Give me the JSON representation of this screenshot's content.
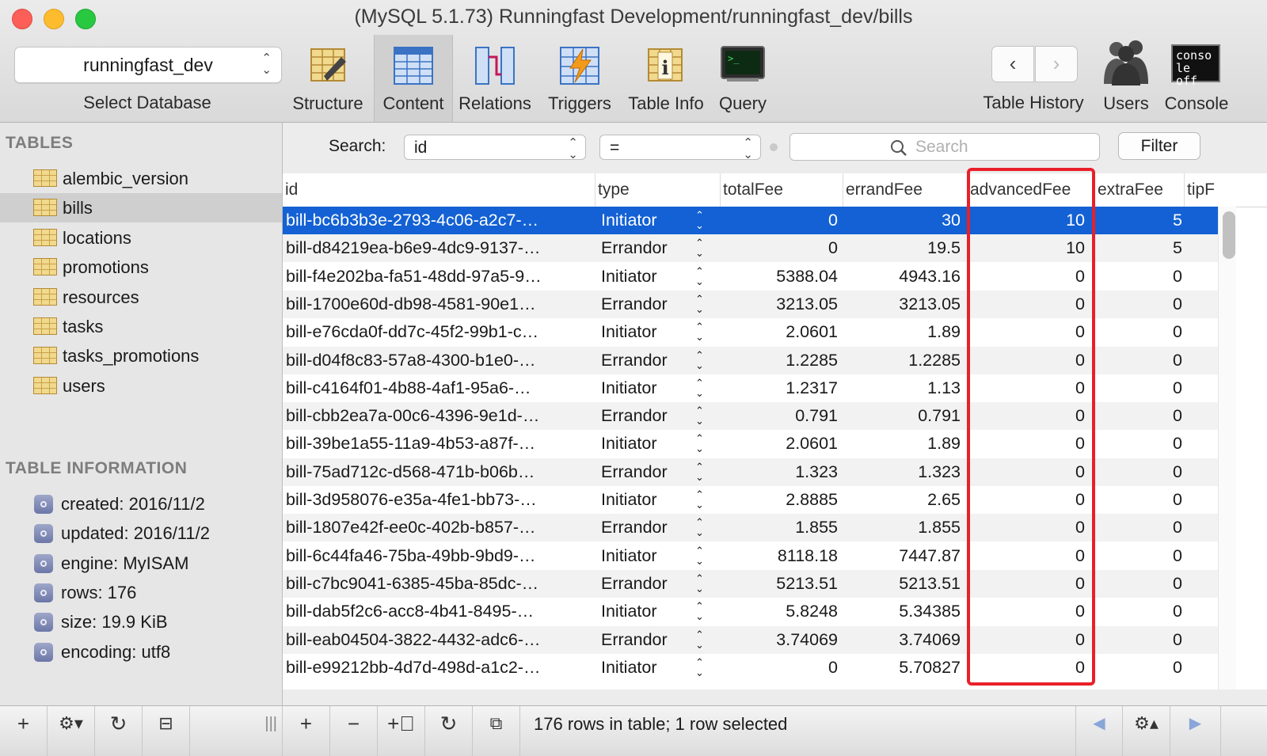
{
  "window": {
    "title": "(MySQL 5.1.73) Runningfast Development/runningfast_dev/bills"
  },
  "toolbar": {
    "database": {
      "value": "runningfast_dev",
      "label": "Select Database"
    },
    "tools": [
      {
        "label": "Structure",
        "icon": "structure-icon"
      },
      {
        "label": "Content",
        "icon": "content-icon"
      },
      {
        "label": "Relations",
        "icon": "relations-icon"
      },
      {
        "label": "Triggers",
        "icon": "triggers-icon"
      },
      {
        "label": "Table Info",
        "icon": "table-info-icon"
      },
      {
        "label": "Query",
        "icon": "query-icon"
      }
    ],
    "history_label": "Table History",
    "users_label": "Users",
    "console_label": "Console",
    "console_icon_text": "conso le off"
  },
  "sidebar": {
    "tables_heading": "TABLES",
    "tables": [
      "alembic_version",
      "bills",
      "locations",
      "promotions",
      "resources",
      "tasks",
      "tasks_promotions",
      "users"
    ],
    "selected_table": "bills",
    "info_heading": "TABLE INFORMATION",
    "info": [
      "created: 2016/11/2",
      "updated: 2016/11/2",
      "engine: MyISAM",
      "rows: 176",
      "size: 19.9 KiB",
      "encoding: utf8"
    ]
  },
  "search": {
    "label": "Search:",
    "field": "id",
    "operator": "=",
    "placeholder": "Search",
    "filter_label": "Filter"
  },
  "grid": {
    "columns": [
      "id",
      "type",
      "totalFee",
      "errandFee",
      "advancedFee",
      "extraFee",
      "tipF"
    ],
    "rows": [
      [
        "bill-bc6b3b3e-2793-4c06-a2c7-…",
        "Initiator",
        "0",
        "30",
        "10",
        "5"
      ],
      [
        "bill-d84219ea-b6e9-4dc9-9137-…",
        "Errandor",
        "0",
        "19.5",
        "10",
        "5"
      ],
      [
        "bill-f4e202ba-fa51-48dd-97a5-9…",
        "Initiator",
        "5388.04",
        "4943.16",
        "0",
        "0"
      ],
      [
        "bill-1700e60d-db98-4581-90e1…",
        "Errandor",
        "3213.05",
        "3213.05",
        "0",
        "0"
      ],
      [
        "bill-e76cda0f-dd7c-45f2-99b1-c…",
        "Initiator",
        "2.0601",
        "1.89",
        "0",
        "0"
      ],
      [
        "bill-d04f8c83-57a8-4300-b1e0-…",
        "Errandor",
        "1.2285",
        "1.2285",
        "0",
        "0"
      ],
      [
        "bill-c4164f01-4b88-4af1-95a6-…",
        "Initiator",
        "1.2317",
        "1.13",
        "0",
        "0"
      ],
      [
        "bill-cbb2ea7a-00c6-4396-9e1d-…",
        "Errandor",
        "0.791",
        "0.791",
        "0",
        "0"
      ],
      [
        "bill-39be1a55-11a9-4b53-a87f-…",
        "Initiator",
        "2.0601",
        "1.89",
        "0",
        "0"
      ],
      [
        "bill-75ad712c-d568-471b-b06b…",
        "Errandor",
        "1.323",
        "1.323",
        "0",
        "0"
      ],
      [
        "bill-3d958076-e35a-4fe1-bb73-…",
        "Initiator",
        "2.8885",
        "2.65",
        "0",
        "0"
      ],
      [
        "bill-1807e42f-ee0c-402b-b857-…",
        "Errandor",
        "1.855",
        "1.855",
        "0",
        "0"
      ],
      [
        "bill-6c44fa46-75ba-49bb-9bd9-…",
        "Initiator",
        "8118.18",
        "7447.87",
        "0",
        "0"
      ],
      [
        "bill-c7bc9041-6385-45ba-85dc-…",
        "Errandor",
        "5213.51",
        "5213.51",
        "0",
        "0"
      ],
      [
        "bill-dab5f2c6-acc8-4b41-8495-…",
        "Initiator",
        "5.8248",
        "5.34385",
        "0",
        "0"
      ],
      [
        "bill-eab04504-3822-4432-adc6-…",
        "Errandor",
        "3.74069",
        "3.74069",
        "0",
        "0"
      ],
      [
        "bill-e99212bb-4d7d-498d-a1c2-…",
        "Initiator",
        "0",
        "5.70827",
        "0",
        "0"
      ]
    ],
    "selected_row": 0
  },
  "status": {
    "text": "176 rows in table; 1 row selected"
  },
  "colors": {
    "selection": "#1361d4",
    "highlight": "#e8202a"
  }
}
